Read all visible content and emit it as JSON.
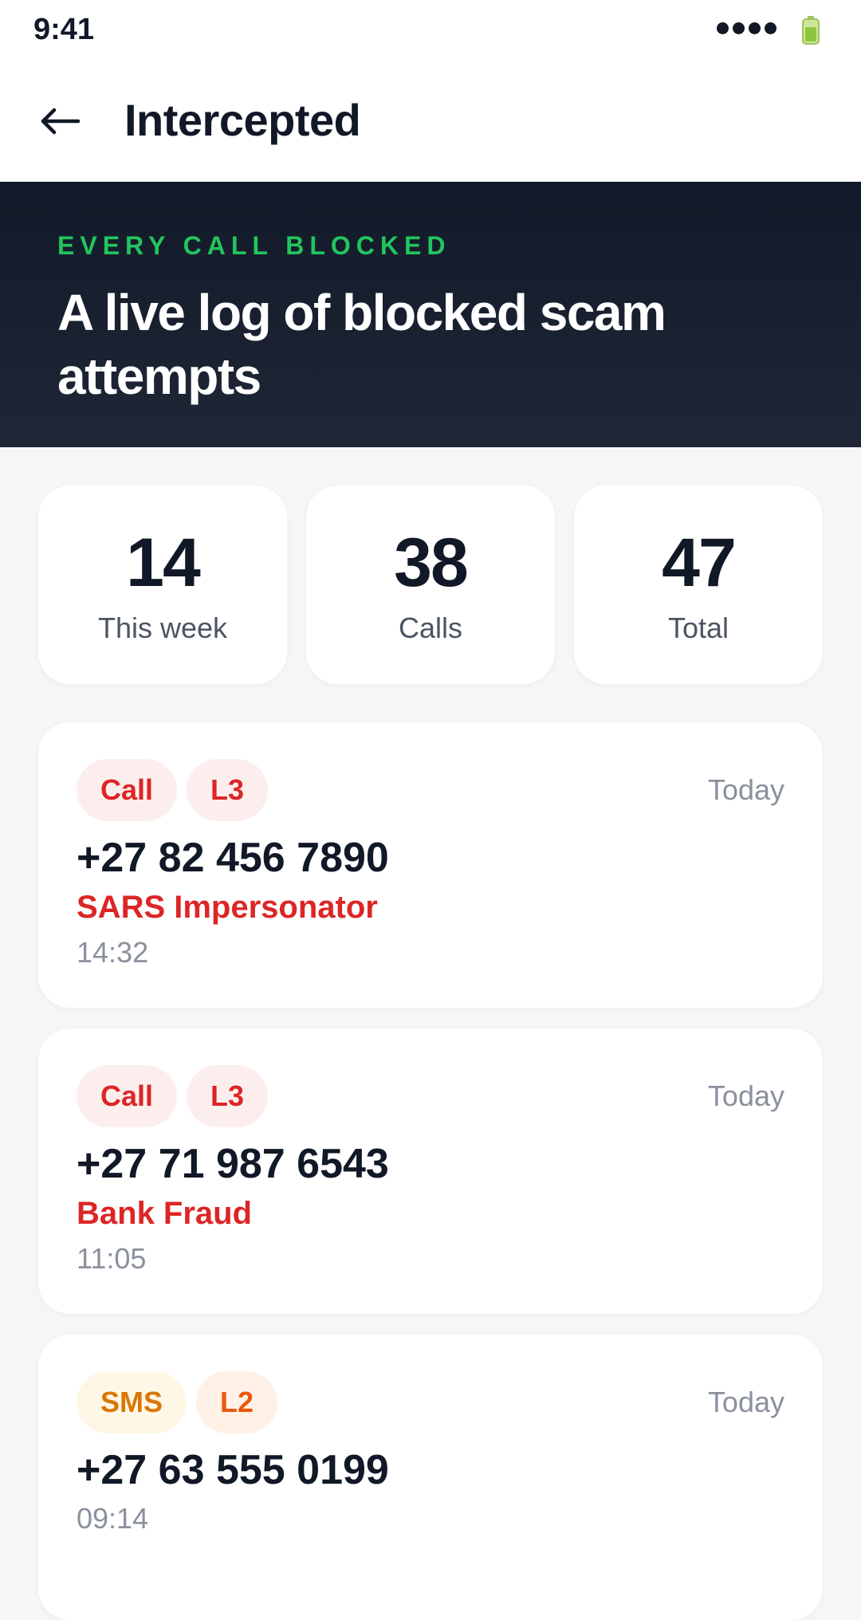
{
  "status_bar": {
    "time": "9:41",
    "signal_icon": "signal-dots-icon",
    "battery_icon": "battery-icon"
  },
  "header": {
    "back_icon": "back-arrow-icon",
    "title": "Intercepted"
  },
  "hero": {
    "eyebrow": "EVERY CALL BLOCKED",
    "heading": "A live log of blocked scam attempts"
  },
  "stats": [
    {
      "value": "14",
      "label": "This week"
    },
    {
      "value": "38",
      "label": "Calls"
    },
    {
      "value": "47",
      "label": "Total"
    }
  ],
  "entries": [
    {
      "tags": [
        {
          "label": "Call",
          "style": "red"
        },
        {
          "label": "L3",
          "style": "red"
        }
      ],
      "date": "Today",
      "number": "+27 82 456 7890",
      "label": "SARS Impersonator",
      "time": "14:32"
    },
    {
      "tags": [
        {
          "label": "Call",
          "style": "red"
        },
        {
          "label": "L3",
          "style": "red"
        }
      ],
      "date": "Today",
      "number": "+27 71 987 6543",
      "label": "Bank Fraud",
      "time": "11:05"
    },
    {
      "tags": [
        {
          "label": "SMS",
          "style": "amber"
        },
        {
          "label": "L2",
          "style": "orange"
        }
      ],
      "date": "Today",
      "number": "+27 63 555 0199",
      "label": "",
      "time": "09:14"
    }
  ],
  "colors": {
    "accent_green": "#22c55e",
    "danger_red": "#dc2626",
    "warning_amber": "#d97706",
    "warning_orange": "#ea580c",
    "hero_background": "#121a29"
  }
}
